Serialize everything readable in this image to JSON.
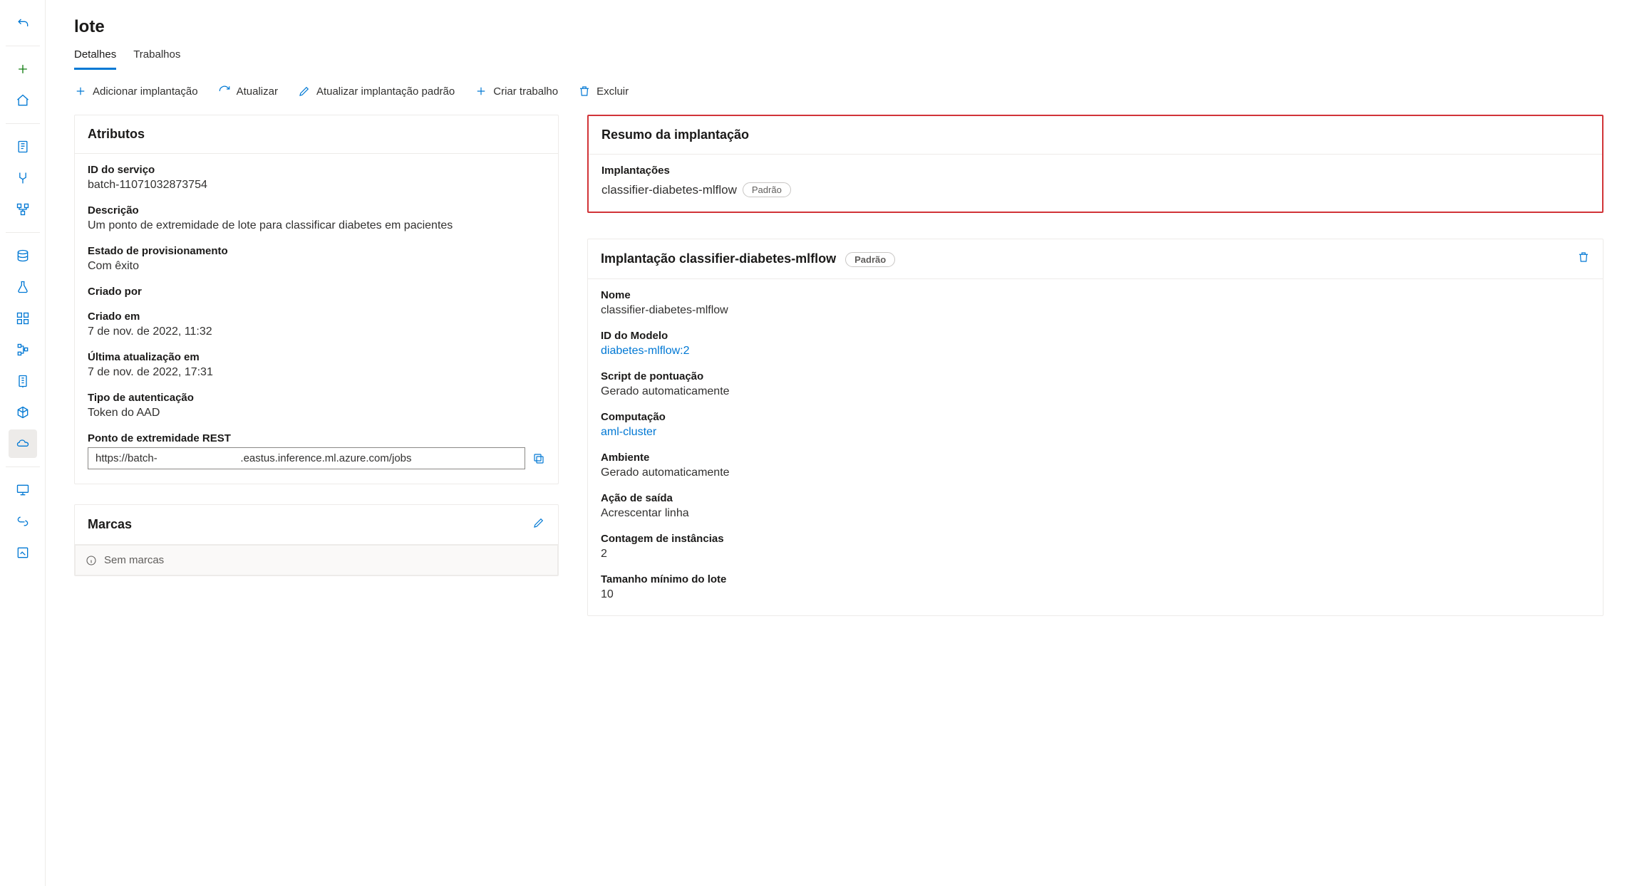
{
  "page": {
    "title": "lote"
  },
  "tabs": {
    "details": "Detalhes",
    "jobs": "Trabalhos"
  },
  "toolbar": {
    "add": "Adicionar implantação",
    "refresh": "Atualizar",
    "update_default": "Atualizar implantação padrão",
    "create_job": "Criar trabalho",
    "delete": "Excluir"
  },
  "attributes": {
    "panel_title": "Atributos",
    "service_id_label": "ID do serviço",
    "service_id_value": "batch-11071032873754",
    "description_label": "Descrição",
    "description_value": "Um ponto de extremidade de lote para classificar diabetes em pacientes",
    "provisioning_label": "Estado de provisionamento",
    "provisioning_value": "Com êxito",
    "created_by_label": "Criado por",
    "created_by_value": "",
    "created_on_label": "Criado em",
    "created_on_value": "7 de nov. de 2022, 11:32",
    "updated_on_label": "Última atualização em",
    "updated_on_value": "7 de nov. de 2022, 17:31",
    "auth_type_label": "Tipo de autenticação",
    "auth_type_value": "Token do AAD",
    "rest_label": "Ponto de extremidade REST",
    "rest_value": "https://batch-                            .eastus.inference.ml.azure.com/jobs"
  },
  "tags": {
    "panel_title": "Marcas",
    "empty_text": "Sem marcas"
  },
  "summary": {
    "panel_title": "Resumo da implantação",
    "deployments_label": "Implantações",
    "deployment_name": "classifier-diabetes-mlflow",
    "default_badge": "Padrão"
  },
  "deployment": {
    "panel_title_prefix": "Implantação",
    "panel_title_name": "classifier-diabetes-mlflow",
    "default_badge": "Padrão",
    "name_label": "Nome",
    "name_value": "classifier-diabetes-mlflow",
    "model_id_label": "ID do Modelo",
    "model_id_value": "diabetes-mlflow:2",
    "scoring_label": "Script de pontuação",
    "scoring_value": "Gerado automaticamente",
    "compute_label": "Computação",
    "compute_value": "aml-cluster",
    "env_label": "Ambiente",
    "env_value": "Gerado automaticamente",
    "output_action_label": "Ação de saída",
    "output_action_value": "Acrescentar linha",
    "instance_count_label": "Contagem de instâncias",
    "instance_count_value": "2",
    "mini_batch_label": "Tamanho mínimo do lote",
    "mini_batch_value": "10"
  }
}
